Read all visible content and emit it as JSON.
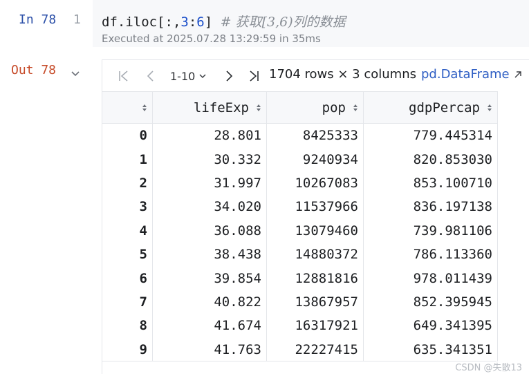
{
  "cell_in": {
    "label": "In 78",
    "line_number": "1",
    "code_pre": "df.iloc[:,",
    "code_num1": "3",
    "code_colon": ":",
    "code_num2": "6",
    "code_post": "] ",
    "code_comment": "# 获取[3,6)列的数据",
    "executed": "Executed at 2025.07.28 13:29:59 in 35ms"
  },
  "cell_out": {
    "label": "Out 78",
    "range": "1-10",
    "rows_info": "1704 rows × 3 columns",
    "type_link": "pd.DataFrame"
  },
  "table": {
    "columns": [
      "lifeExp",
      "pop",
      "gdpPercap"
    ],
    "rows": [
      {
        "index": "0",
        "lifeExp": "28.801",
        "pop": "8425333",
        "gdpPercap": "779.445314"
      },
      {
        "index": "1",
        "lifeExp": "30.332",
        "pop": "9240934",
        "gdpPercap": "820.853030"
      },
      {
        "index": "2",
        "lifeExp": "31.997",
        "pop": "10267083",
        "gdpPercap": "853.100710"
      },
      {
        "index": "3",
        "lifeExp": "34.020",
        "pop": "11537966",
        "gdpPercap": "836.197138"
      },
      {
        "index": "4",
        "lifeExp": "36.088",
        "pop": "13079460",
        "gdpPercap": "739.981106"
      },
      {
        "index": "5",
        "lifeExp": "38.438",
        "pop": "14880372",
        "gdpPercap": "786.113360"
      },
      {
        "index": "6",
        "lifeExp": "39.854",
        "pop": "12881816",
        "gdpPercap": "978.011439"
      },
      {
        "index": "7",
        "lifeExp": "40.822",
        "pop": "13867957",
        "gdpPercap": "852.395945"
      },
      {
        "index": "8",
        "lifeExp": "41.674",
        "pop": "16317921",
        "gdpPercap": "649.341395"
      },
      {
        "index": "9",
        "lifeExp": "41.763",
        "pop": "22227415",
        "gdpPercap": "635.341351"
      }
    ]
  },
  "watermark": "CSDN @失散13",
  "colors": {
    "in_label": "#2b4fa8",
    "out_label": "#c64a28",
    "link": "#2f5fc4",
    "number": "#1a4ec9"
  }
}
